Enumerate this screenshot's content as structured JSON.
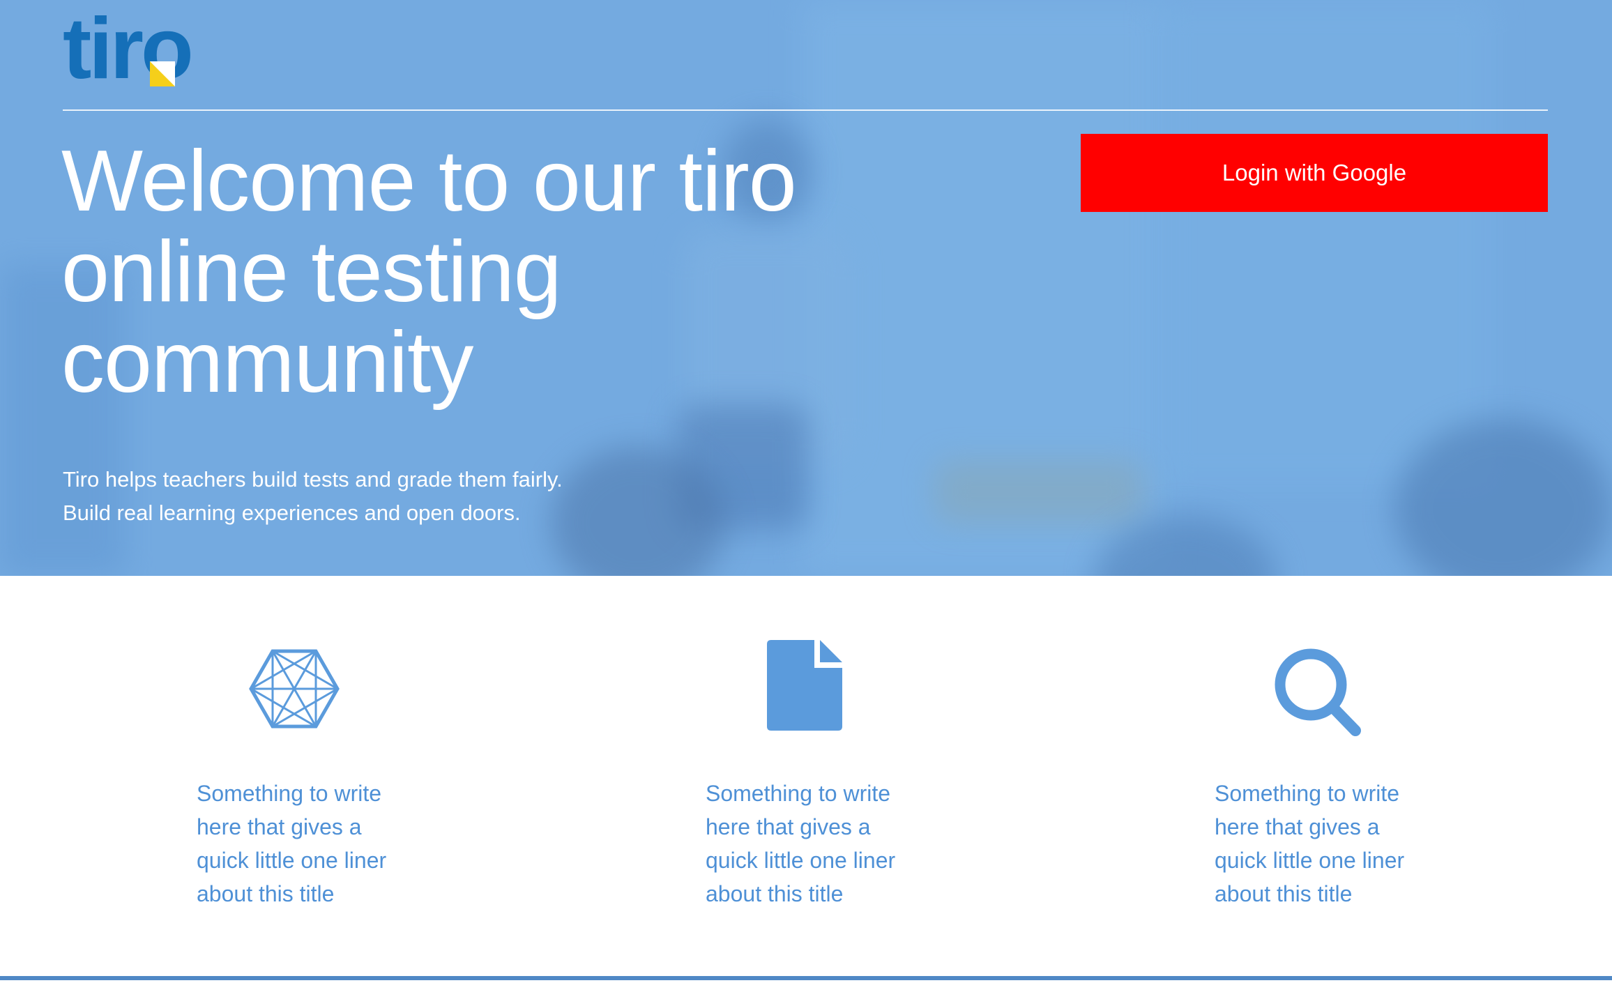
{
  "brand": {
    "name": "tiro"
  },
  "hero": {
    "title": "Welcome to our tiro online testing community",
    "subtitle_lines": [
      "Tiro helps teachers build tests and grade them fairly.",
      "Build real learning experiences and open doors."
    ]
  },
  "auth": {
    "login_label": "Login with Google"
  },
  "features": [
    {
      "icon": "hexagon-network-icon",
      "text": "Something to write here that gives a quick little one liner about this title"
    },
    {
      "icon": "document-icon",
      "text": "Something to write here that gives a quick little one liner about this title"
    },
    {
      "icon": "search-icon",
      "text": "Something to write here that gives a quick little one liner about this title"
    }
  ],
  "colors": {
    "hero_background": "#74aae0",
    "brand_blue": "#156fb8",
    "logo_accent": "#f5cf1a",
    "login_button": "#ff0000",
    "feature_blue": "#4e90d6"
  }
}
